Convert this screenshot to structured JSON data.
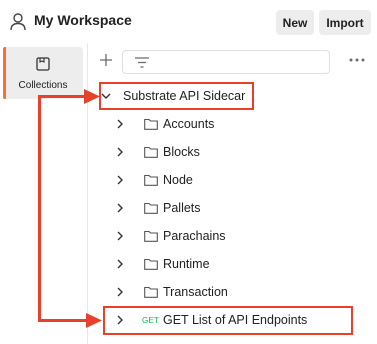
{
  "header": {
    "title": "My Workspace",
    "new_label": "New",
    "import_label": "Import"
  },
  "rail": {
    "active_label": "Collections"
  },
  "collection": {
    "name": "Substrate API Sidecar",
    "folders": [
      "Accounts",
      "Blocks",
      "Node",
      "Pallets",
      "Parachains",
      "Runtime",
      "Transaction"
    ],
    "request": {
      "method": "GET",
      "name": "GET List of API Endpoints"
    }
  },
  "colors": {
    "accent": "#ff6c37",
    "annotation": "#e8402a",
    "get_method": "#0cbb52"
  },
  "icons": [
    "user-icon",
    "collections-icon",
    "plus-icon",
    "filter-icon",
    "more-icon",
    "chevron-down-icon",
    "chevron-right-icon",
    "folder-icon",
    "arrow-icon"
  ]
}
